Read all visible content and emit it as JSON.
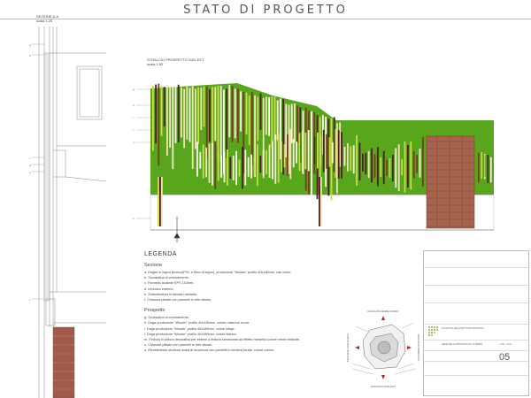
{
  "page": {
    "title": "STATO DI PROGETTO"
  },
  "section": {
    "name": "SEZIONE A-A",
    "scale": "scala 1:20"
  },
  "elevation": {
    "name": "STRALCIO PROSPETTO SUD-EST",
    "scale": "scala 1:50"
  },
  "legend": {
    "title": "LEGENDA",
    "sezione_title": "Sezione",
    "sezione_items": [
      "a. Doghe in legno tecnico(PVC e fibra di legno), produzione \"Woodn\" profilo 40x180mm, vari colori.",
      "b. Scossalina di coronamento.",
      "c. Pannello isolante EPS 110mm.",
      "d. Intonaco esterno.",
      "e. Sottostruttura in tubolari metallici.",
      "f. Chiusura pilastri con pannelli in rete stirata."
    ],
    "prospetto_title": "Prospetto",
    "prospetto_items": [
      "g. Scossalina di coronamento.",
      "h. Doga produzione \"Woodn\" profilo 40x180mm, colore marrone scuro.",
      "i. Doga produzione \"Woodn\" profilo 40x180mm, colore beige.",
      "l. Doga produzione \"Woodn\" profilo 40x180mm, colore bianco.",
      "m. Finitura in pittura decorativa per esterni a finitura semilucida ad effetto metallico,colore verde brillante.",
      "n. Chiusura pilastri con pannelli in rete stirata.",
      "o. Rivestimento strutture scala di sicurezza con pannelli in lamiera forata, colore corten."
    ]
  },
  "plan": {
    "labels": [
      "FACCIATA NORD-OVEST",
      "FACCIATA SUD-EST",
      "FACCIATA SUD-OVEST",
      "FACCIATA NORD-EST"
    ]
  },
  "titleblock": {
    "lines": [
      "",
      "",
      "",
      "STUDIO DI ARCHITETTURA ASSOCIATI",
      "",
      "SEDE DELLA PROVINCIA DI VITERBO",
      "",
      "1:50 - 1:20",
      "",
      "05"
    ],
    "sheet_number": "05"
  },
  "colors": {
    "green": "#57a61c",
    "lime": "#c7dd4a",
    "beige": "#ece6b0",
    "white": "#fbfbea",
    "dark_brown": "#4b2214",
    "red_brown": "#7a3a22",
    "corten": "#a6644f"
  }
}
